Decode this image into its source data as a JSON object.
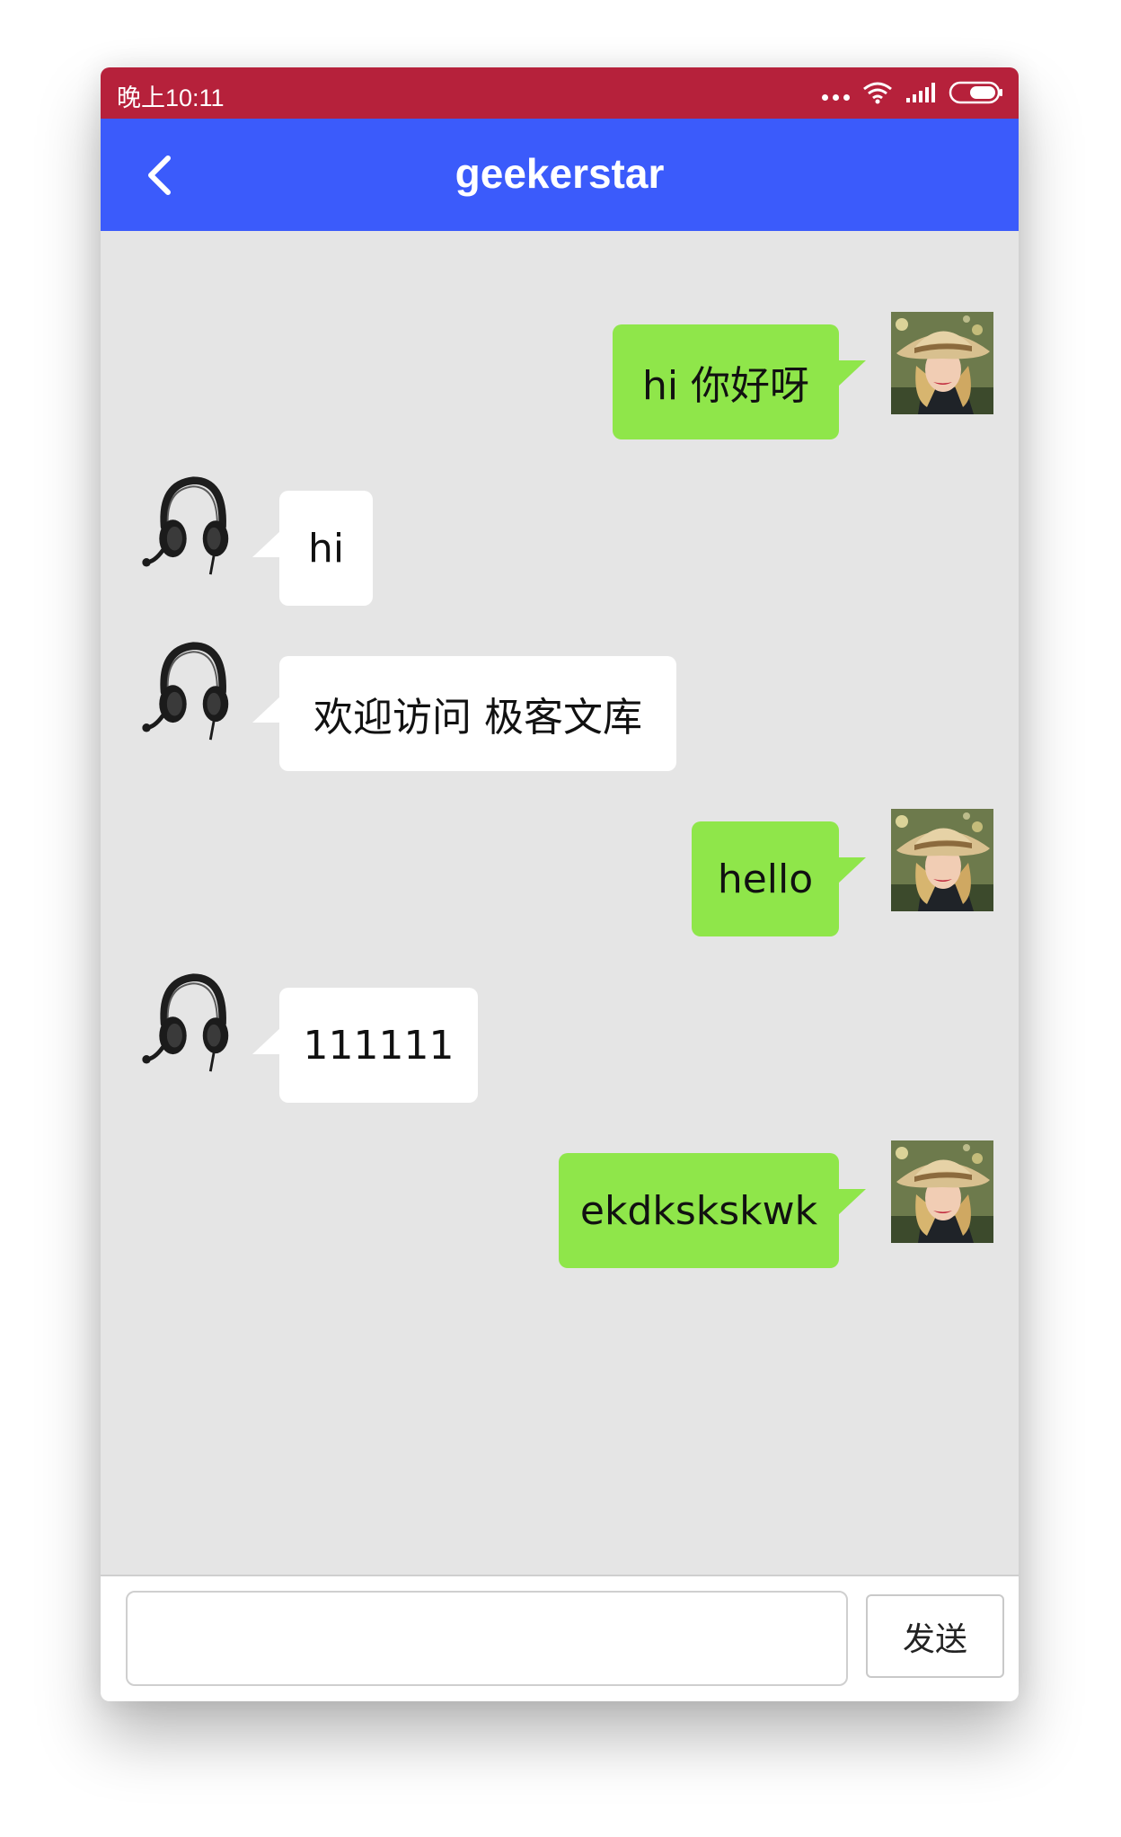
{
  "status_bar": {
    "time": "晚上10:11",
    "icons": [
      "more-dots-icon",
      "wifi-icon",
      "signal-icon",
      "battery-icon"
    ]
  },
  "app_bar": {
    "back_icon": "chevron-left-icon",
    "title": "geekerstar"
  },
  "messages": [
    {
      "sender": "me",
      "text": "hi 你好呀",
      "avatar": "woman-hat-photo"
    },
    {
      "sender": "other",
      "text": "hi",
      "avatar": "headset-icon"
    },
    {
      "sender": "other",
      "text": "欢迎访问 极客文库",
      "avatar": "headset-icon"
    },
    {
      "sender": "me",
      "text": "hello",
      "avatar": "woman-hat-photo"
    },
    {
      "sender": "other",
      "text": "111111",
      "avatar": "headset-icon"
    },
    {
      "sender": "me",
      "text": "ekdkskskwk",
      "avatar": "woman-hat-photo"
    }
  ],
  "composer": {
    "input_value": "",
    "send_label": "发送"
  },
  "colors": {
    "status_bar": "#b6213b",
    "app_bar": "#3b5bfb",
    "chat_background": "#e5e5e5",
    "my_bubble": "#8fe64a",
    "other_bubble": "#ffffff"
  }
}
